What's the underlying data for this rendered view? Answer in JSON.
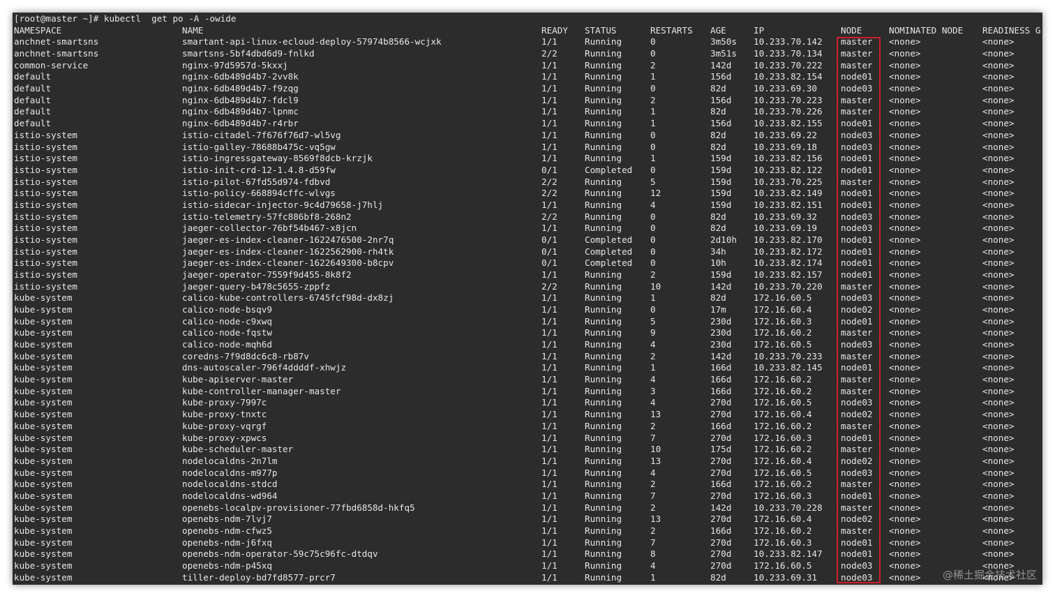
{
  "prompt": "[root@master ~]# kubectl  get po -A -owide",
  "columns": [
    "NAMESPACE",
    "NAME",
    "READY",
    "STATUS",
    "RESTARTS",
    "AGE",
    "IP",
    "NODE",
    "NOMINATED NODE",
    "READINESS G"
  ],
  "rows": [
    [
      "anchnet-smartsns",
      "smartant-api-linux-ecloud-deploy-57974b8566-wcjxk",
      "1/1",
      "Running",
      "0",
      "3m50s",
      "10.233.70.142",
      "master",
      "<none>",
      "<none>"
    ],
    [
      "anchnet-smartsns",
      "smartsns-5bf4dbd6d9-fnlkd",
      "2/2",
      "Running",
      "0",
      "3m51s",
      "10.233.70.134",
      "master",
      "<none>",
      "<none>"
    ],
    [
      "common-service",
      "nginx-97d5957d-5kxxj",
      "1/1",
      "Running",
      "2",
      "142d",
      "10.233.70.222",
      "master",
      "<none>",
      "<none>"
    ],
    [
      "default",
      "nginx-6db489d4b7-2vv8k",
      "1/1",
      "Running",
      "1",
      "156d",
      "10.233.82.154",
      "node01",
      "<none>",
      "<none>"
    ],
    [
      "default",
      "nginx-6db489d4b7-f9zqg",
      "1/1",
      "Running",
      "0",
      "82d",
      "10.233.69.30",
      "node03",
      "<none>",
      "<none>"
    ],
    [
      "default",
      "nginx-6db489d4b7-fdcl9",
      "1/1",
      "Running",
      "2",
      "156d",
      "10.233.70.223",
      "master",
      "<none>",
      "<none>"
    ],
    [
      "default",
      "nginx-6db489d4b7-lpnmc",
      "1/1",
      "Running",
      "1",
      "82d",
      "10.233.70.226",
      "master",
      "<none>",
      "<none>"
    ],
    [
      "default",
      "nginx-6db489d4b7-r4rbr",
      "1/1",
      "Running",
      "1",
      "156d",
      "10.233.82.155",
      "node01",
      "<none>",
      "<none>"
    ],
    [
      "istio-system",
      "istio-citadel-7f676f76d7-wl5vg",
      "1/1",
      "Running",
      "0",
      "82d",
      "10.233.69.22",
      "node03",
      "<none>",
      "<none>"
    ],
    [
      "istio-system",
      "istio-galley-78688b475c-vq5gw",
      "1/1",
      "Running",
      "0",
      "82d",
      "10.233.69.18",
      "node03",
      "<none>",
      "<none>"
    ],
    [
      "istio-system",
      "istio-ingressgateway-8569f8dcb-krzjk",
      "1/1",
      "Running",
      "1",
      "159d",
      "10.233.82.156",
      "node01",
      "<none>",
      "<none>"
    ],
    [
      "istio-system",
      "istio-init-crd-12-1.4.8-d59fw",
      "0/1",
      "Completed",
      "0",
      "159d",
      "10.233.82.122",
      "node01",
      "<none>",
      "<none>"
    ],
    [
      "istio-system",
      "istio-pilot-67fd55d974-fdbvd",
      "2/2",
      "Running",
      "5",
      "159d",
      "10.233.70.225",
      "master",
      "<none>",
      "<none>"
    ],
    [
      "istio-system",
      "istio-policy-668894cffc-wlvgs",
      "2/2",
      "Running",
      "12",
      "159d",
      "10.233.82.149",
      "node01",
      "<none>",
      "<none>"
    ],
    [
      "istio-system",
      "istio-sidecar-injector-9c4d79658-j7hlj",
      "1/1",
      "Running",
      "4",
      "159d",
      "10.233.82.151",
      "node01",
      "<none>",
      "<none>"
    ],
    [
      "istio-system",
      "istio-telemetry-57fc886bf8-268n2",
      "2/2",
      "Running",
      "0",
      "82d",
      "10.233.69.32",
      "node03",
      "<none>",
      "<none>"
    ],
    [
      "istio-system",
      "jaeger-collector-76bf54b467-x8jcn",
      "1/1",
      "Running",
      "0",
      "82d",
      "10.233.69.19",
      "node03",
      "<none>",
      "<none>"
    ],
    [
      "istio-system",
      "jaeger-es-index-cleaner-1622476500-2nr7q",
      "0/1",
      "Completed",
      "0",
      "2d10h",
      "10.233.82.170",
      "node01",
      "<none>",
      "<none>"
    ],
    [
      "istio-system",
      "jaeger-es-index-cleaner-1622562900-rh4tk",
      "0/1",
      "Completed",
      "0",
      "34h",
      "10.233.82.172",
      "node01",
      "<none>",
      "<none>"
    ],
    [
      "istio-system",
      "jaeger-es-index-cleaner-1622649300-b8cpv",
      "0/1",
      "Completed",
      "0",
      "10h",
      "10.233.82.174",
      "node01",
      "<none>",
      "<none>"
    ],
    [
      "istio-system",
      "jaeger-operator-7559f9d455-8k8f2",
      "1/1",
      "Running",
      "2",
      "159d",
      "10.233.82.157",
      "node01",
      "<none>",
      "<none>"
    ],
    [
      "istio-system",
      "jaeger-query-b478c5655-zppfz",
      "2/2",
      "Running",
      "10",
      "142d",
      "10.233.70.220",
      "master",
      "<none>",
      "<none>"
    ],
    [
      "kube-system",
      "calico-kube-controllers-6745fcf98d-dx8zj",
      "1/1",
      "Running",
      "1",
      "82d",
      "172.16.60.5",
      "node03",
      "<none>",
      "<none>"
    ],
    [
      "kube-system",
      "calico-node-bsqv9",
      "1/1",
      "Running",
      "0",
      "17m",
      "172.16.60.4",
      "node02",
      "<none>",
      "<none>"
    ],
    [
      "kube-system",
      "calico-node-c9xwq",
      "1/1",
      "Running",
      "5",
      "230d",
      "172.16.60.3",
      "node01",
      "<none>",
      "<none>"
    ],
    [
      "kube-system",
      "calico-node-fqstw",
      "1/1",
      "Running",
      "9",
      "230d",
      "172.16.60.2",
      "master",
      "<none>",
      "<none>"
    ],
    [
      "kube-system",
      "calico-node-mqh6d",
      "1/1",
      "Running",
      "4",
      "230d",
      "172.16.60.5",
      "node03",
      "<none>",
      "<none>"
    ],
    [
      "kube-system",
      "coredns-7f9d8dc6c8-rb87v",
      "1/1",
      "Running",
      "2",
      "142d",
      "10.233.70.233",
      "master",
      "<none>",
      "<none>"
    ],
    [
      "kube-system",
      "dns-autoscaler-796f4ddddf-xhwjz",
      "1/1",
      "Running",
      "1",
      "166d",
      "10.233.82.145",
      "node01",
      "<none>",
      "<none>"
    ],
    [
      "kube-system",
      "kube-apiserver-master",
      "1/1",
      "Running",
      "4",
      "166d",
      "172.16.60.2",
      "master",
      "<none>",
      "<none>"
    ],
    [
      "kube-system",
      "kube-controller-manager-master",
      "1/1",
      "Running",
      "3",
      "166d",
      "172.16.60.2",
      "master",
      "<none>",
      "<none>"
    ],
    [
      "kube-system",
      "kube-proxy-7997c",
      "1/1",
      "Running",
      "4",
      "270d",
      "172.16.60.5",
      "node03",
      "<none>",
      "<none>"
    ],
    [
      "kube-system",
      "kube-proxy-tnxtc",
      "1/1",
      "Running",
      "13",
      "270d",
      "172.16.60.4",
      "node02",
      "<none>",
      "<none>"
    ],
    [
      "kube-system",
      "kube-proxy-vqrgf",
      "1/1",
      "Running",
      "2",
      "166d",
      "172.16.60.2",
      "master",
      "<none>",
      "<none>"
    ],
    [
      "kube-system",
      "kube-proxy-xpwcs",
      "1/1",
      "Running",
      "7",
      "270d",
      "172.16.60.3",
      "node01",
      "<none>",
      "<none>"
    ],
    [
      "kube-system",
      "kube-scheduler-master",
      "1/1",
      "Running",
      "10",
      "175d",
      "172.16.60.2",
      "master",
      "<none>",
      "<none>"
    ],
    [
      "kube-system",
      "nodelocaldns-2n7lm",
      "1/1",
      "Running",
      "13",
      "270d",
      "172.16.60.4",
      "node02",
      "<none>",
      "<none>"
    ],
    [
      "kube-system",
      "nodelocaldns-m977p",
      "1/1",
      "Running",
      "4",
      "270d",
      "172.16.60.5",
      "node03",
      "<none>",
      "<none>"
    ],
    [
      "kube-system",
      "nodelocaldns-stdcd",
      "1/1",
      "Running",
      "2",
      "166d",
      "172.16.60.2",
      "master",
      "<none>",
      "<none>"
    ],
    [
      "kube-system",
      "nodelocaldns-wd964",
      "1/1",
      "Running",
      "7",
      "270d",
      "172.16.60.3",
      "node01",
      "<none>",
      "<none>"
    ],
    [
      "kube-system",
      "openebs-localpv-provisioner-77fbd6858d-hkfq5",
      "1/1",
      "Running",
      "2",
      "142d",
      "10.233.70.228",
      "master",
      "<none>",
      "<none>"
    ],
    [
      "kube-system",
      "openebs-ndm-7lvj7",
      "1/1",
      "Running",
      "13",
      "270d",
      "172.16.60.4",
      "node02",
      "<none>",
      "<none>"
    ],
    [
      "kube-system",
      "openebs-ndm-cfwz5",
      "1/1",
      "Running",
      "2",
      "166d",
      "172.16.60.2",
      "master",
      "<none>",
      "<none>"
    ],
    [
      "kube-system",
      "openebs-ndm-j6fxq",
      "1/1",
      "Running",
      "7",
      "270d",
      "172.16.60.3",
      "node01",
      "<none>",
      "<none>"
    ],
    [
      "kube-system",
      "openebs-ndm-operator-59c75c96fc-dtdqv",
      "1/1",
      "Running",
      "8",
      "270d",
      "10.233.82.147",
      "node01",
      "<none>",
      "<none>"
    ],
    [
      "kube-system",
      "openebs-ndm-p45xq",
      "1/1",
      "Running",
      "4",
      "270d",
      "172.16.60.5",
      "node03",
      "<none>",
      "<none>"
    ],
    [
      "kube-system",
      "tiller-deploy-bd7fd8577-prcr7",
      "1/1",
      "Running",
      "1",
      "82d",
      "10.233.69.31",
      "node03",
      "<none>",
      "<none>"
    ]
  ],
  "watermark": "@稀土掘金技术社区",
  "colors": {
    "terminal_bg": "#2c2c2c",
    "text": "#e6e6e6",
    "highlight": "#d0202a"
  }
}
